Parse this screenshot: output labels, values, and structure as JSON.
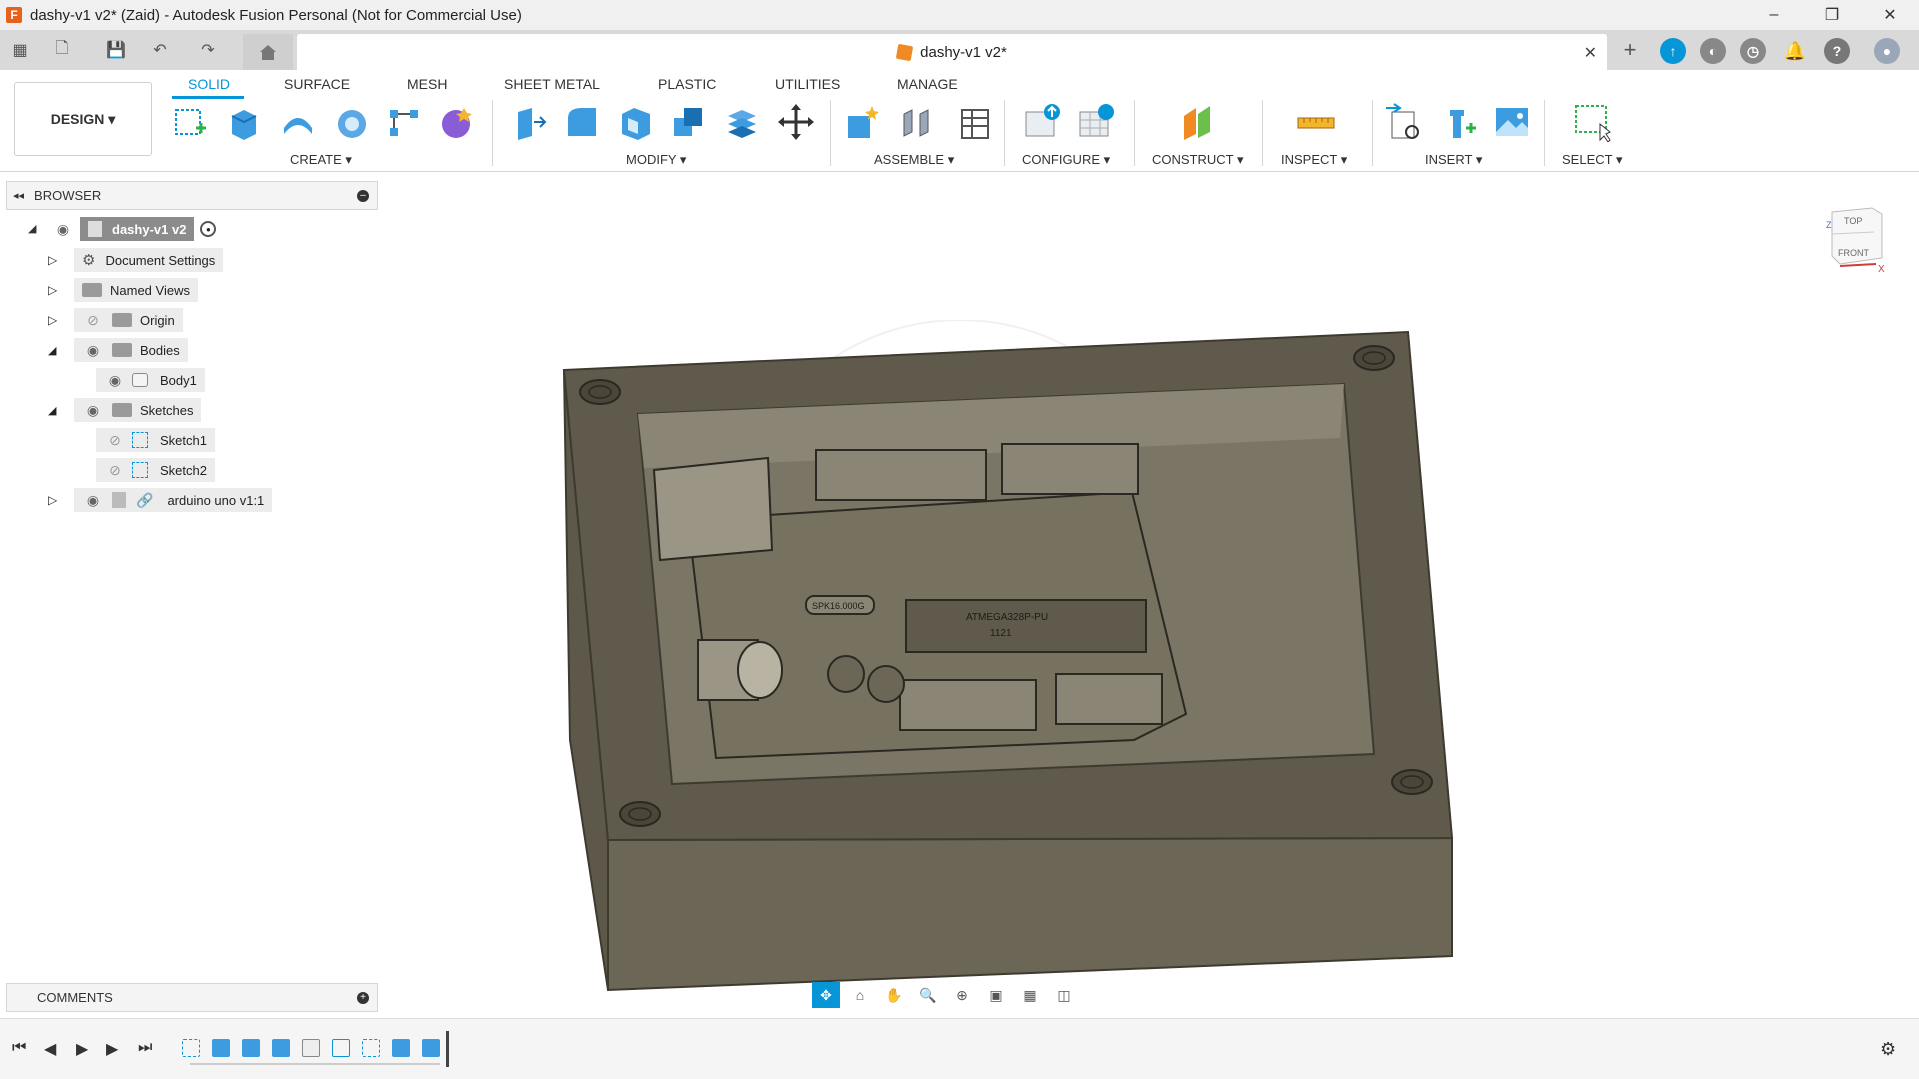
{
  "window": {
    "title": "dashy-v1 v2* (Zaid) - Autodesk Fusion Personal (Not for Commercial Use)",
    "minimize": "–",
    "maximize": "❐",
    "close": "✕"
  },
  "tabs": {
    "document": "dashy-v1 v2*",
    "close": "✕"
  },
  "toolbar": {
    "workspace": "DESIGN ▾",
    "workspace_tabs": [
      "SOLID",
      "SURFACE",
      "MESH",
      "SHEET METAL",
      "PLASTIC",
      "UTILITIES",
      "MANAGE"
    ],
    "groups": [
      "CREATE ▾",
      "MODIFY ▾",
      "ASSEMBLE ▾",
      "CONFIGURE ▾",
      "CONSTRUCT ▾",
      "INSPECT ▾",
      "INSERT ▾",
      "SELECT ▾"
    ]
  },
  "browser": {
    "title": "BROWSER",
    "root": "dashy-v1 v2",
    "items": {
      "document_settings": "Document Settings",
      "named_views": "Named Views",
      "origin": "Origin",
      "bodies": "Bodies",
      "body1": "Body1",
      "sketches": "Sketches",
      "sketch1": "Sketch1",
      "sketch2": "Sketch2",
      "arduino": "arduino uno v1:1"
    }
  },
  "viewport": {
    "board_chip_label": "ATMEGA328P-PU",
    "crystal_label": "SPK16.000G",
    "chip_number": "1121"
  },
  "viewcube": {
    "top": "TOP",
    "front": "FRONT",
    "z": "Z",
    "x": "X"
  },
  "comments": {
    "title": "COMMENTS"
  },
  "colors": {
    "accent": "#0696d7",
    "body": "#6b6656",
    "body_top": "#5f5a4c",
    "board": "#77725f"
  }
}
